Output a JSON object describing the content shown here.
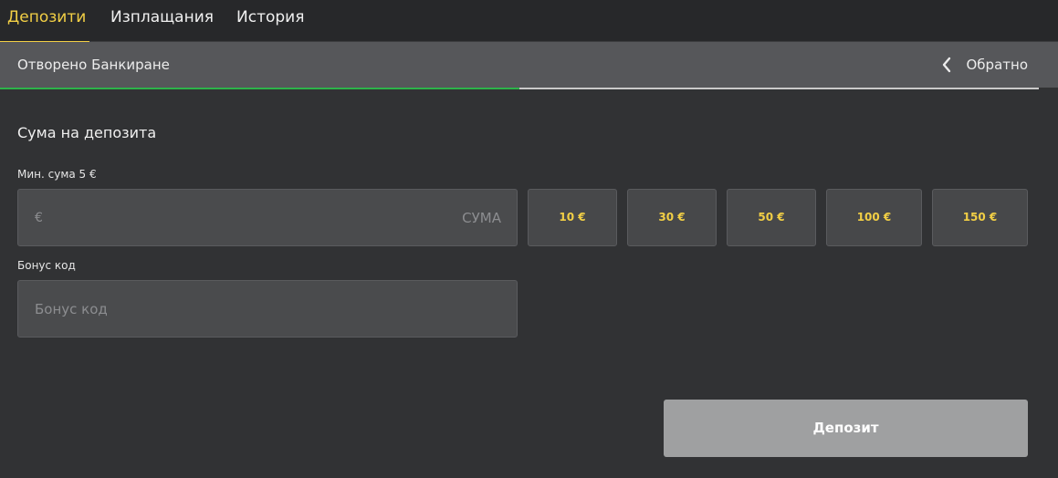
{
  "tabs": [
    {
      "label": "Депозити",
      "active": true
    },
    {
      "label": "Изплащания",
      "active": false
    },
    {
      "label": "История",
      "active": false
    }
  ],
  "subheader": {
    "title": "Отворено Банкиране",
    "back_label": "Обратно",
    "back_icon": "chevron-left-icon",
    "progress_percent": 50,
    "progress_color": "#2db34a"
  },
  "form": {
    "section_title": "Сума на депозита",
    "min_amount_label": "Мин. сума 5 €",
    "amount_prefix": "€",
    "amount_placeholder": "СУМА",
    "amount_value": "",
    "quick_amounts": [
      "10 €",
      "30 €",
      "50 €",
      "100 €",
      "150 €"
    ],
    "bonus_label": "Бонус код",
    "bonus_placeholder": "Бонус код",
    "bonus_value": "",
    "submit_label": "Депозит"
  },
  "colors": {
    "accent": "#f2cf45",
    "background": "#313234",
    "tabbar": "#27282a",
    "subheader": "#56575a",
    "button_disabled": "#9fa0a1"
  }
}
